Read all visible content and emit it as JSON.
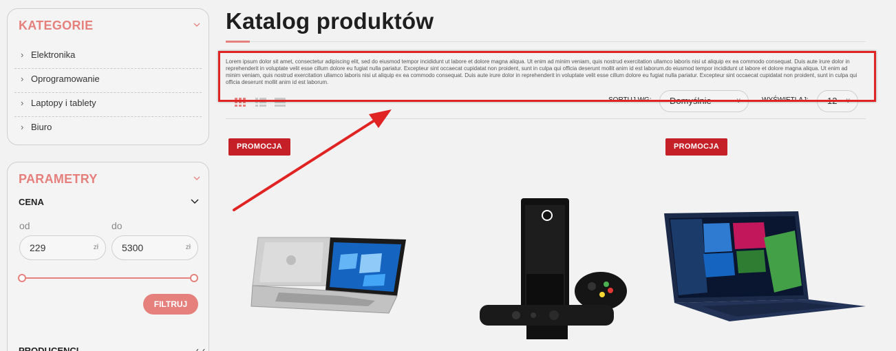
{
  "sidebar": {
    "categories": {
      "title": "KATEGORIE",
      "items": [
        {
          "label": "Elektronika"
        },
        {
          "label": "Oprogramowanie"
        },
        {
          "label": "Laptopy i tablety"
        },
        {
          "label": "Biuro"
        }
      ]
    },
    "parameters": {
      "title": "PARAMETRY",
      "price_heading": "CENA",
      "from_label": "od",
      "to_label": "do",
      "min_value": "229",
      "max_value": "5300",
      "currency": "zł",
      "filter_button": "FILTRUJ",
      "producers_heading": "PRODUCENCI"
    }
  },
  "main": {
    "title": "Katalog produktów",
    "description": "Lorem ipsum dolor sit amet, consectetur adipiscing elit, sed do eiusmod tempor incididunt ut labore et dolore magna aliqua. Ut enim ad minim veniam, quis nostrud exercitation ullamco laboris nisi ut aliquip ex ea commodo consequat. Duis aute irure dolor in reprehenderit in voluptate velit esse cillum dolore eu fugiat nulla pariatur. Excepteur sint occaecat cupidatat non proident, sunt in culpa qui officia deserunt mollit anim id est laborum.do eiusmod tempor incididunt ut labore et dolore magna aliqua. Ut enim ad minim veniam, quis nostrud exercitation ullamco laboris nisi ut aliquip ex ea commodo consequat. Duis aute irure dolor in reprehenderit in voluptate velit esse cillum dolore eu fugiat nulla pariatur. Excepteur sint occaecat cupidatat non proident, sunt in culpa qui officia deserunt mollit anim id est laborum.",
    "toolbar": {
      "sort_label": "SORTUJ WG:",
      "sort_value": "Domyślnie",
      "show_label": "WYŚWIETLAJ:",
      "show_value": "12"
    },
    "products": [
      {
        "badge": "PROMOCJA",
        "image": "laptop-hp"
      },
      {
        "badge": "",
        "image": "xbox-console"
      },
      {
        "badge": "PROMOCJA",
        "image": "laptop-acer"
      }
    ]
  },
  "colors": {
    "accent": "#e5807d",
    "badge": "#c51f27",
    "annotation": "#e02424"
  }
}
